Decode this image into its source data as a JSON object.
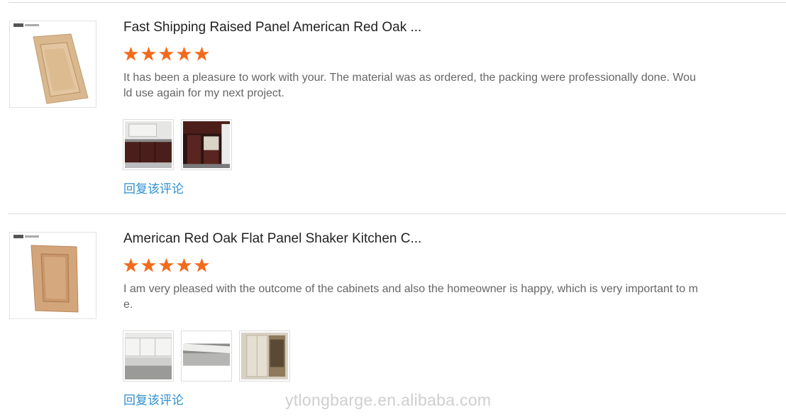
{
  "reviews": [
    {
      "product_title": "Fast Shipping Raised Panel American Red Oak ...",
      "rating": 5,
      "rating_max": 5,
      "text": "It has been a pleasure to work with your. The material was as ordered, the packing were professionally done. Would use again for my next project.",
      "photo_count": 2,
      "reply_label": "回复该评论"
    },
    {
      "product_title": "American Red Oak Flat Panel Shaker Kitchen C...",
      "rating": 5,
      "rating_max": 5,
      "text": "I am very pleased with the outcome of the cabinets and also the homeowner is happy, which is very important to me.",
      "photo_count": 3,
      "reply_label": "回复该评论"
    }
  ],
  "watermark": "ytlongbarge.en.alibaba.com",
  "colors": {
    "star": "#f26b1d",
    "link": "#2f8fcf",
    "divider": "#d9d9d9"
  }
}
